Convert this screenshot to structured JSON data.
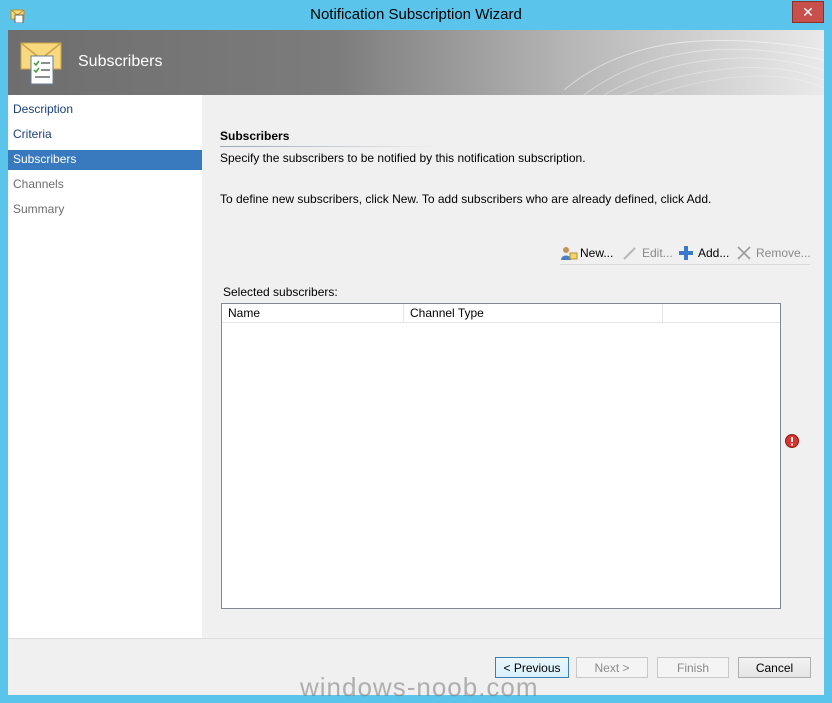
{
  "window": {
    "title": "Notification Subscription Wizard",
    "close_label": "✕"
  },
  "header": {
    "title": "Subscribers"
  },
  "nav": {
    "items": [
      {
        "label": "Description",
        "state": "normal"
      },
      {
        "label": "Criteria",
        "state": "normal"
      },
      {
        "label": "Subscribers",
        "state": "active"
      },
      {
        "label": "Channels",
        "state": "disabled"
      },
      {
        "label": "Summary",
        "state": "disabled"
      }
    ]
  },
  "page": {
    "section_title": "Subscribers",
    "description": "Specify the subscribers to be notified by this notification subscription.",
    "instruction": "To define new subscribers, click New.  To add subscribers who are already defined, click Add.",
    "toolbar": {
      "new_label": "New...",
      "edit_label": "Edit...",
      "add_label": "Add...",
      "remove_label": "Remove..."
    },
    "list_label": "Selected subscribers:",
    "columns": [
      "Name",
      "Channel Type"
    ],
    "rows": []
  },
  "footer": {
    "previous_label": "< Previous",
    "next_label": "Next >",
    "finish_label": "Finish",
    "cancel_label": "Cancel"
  },
  "watermark": "windows-noob.com",
  "colors": {
    "titlebar": "#5bc4ea",
    "nav_active": "#3979be",
    "close": "#c7504c",
    "error": "#d9342b"
  },
  "icons": {
    "app": "wizard-envelope-icon",
    "error": "error-icon"
  }
}
